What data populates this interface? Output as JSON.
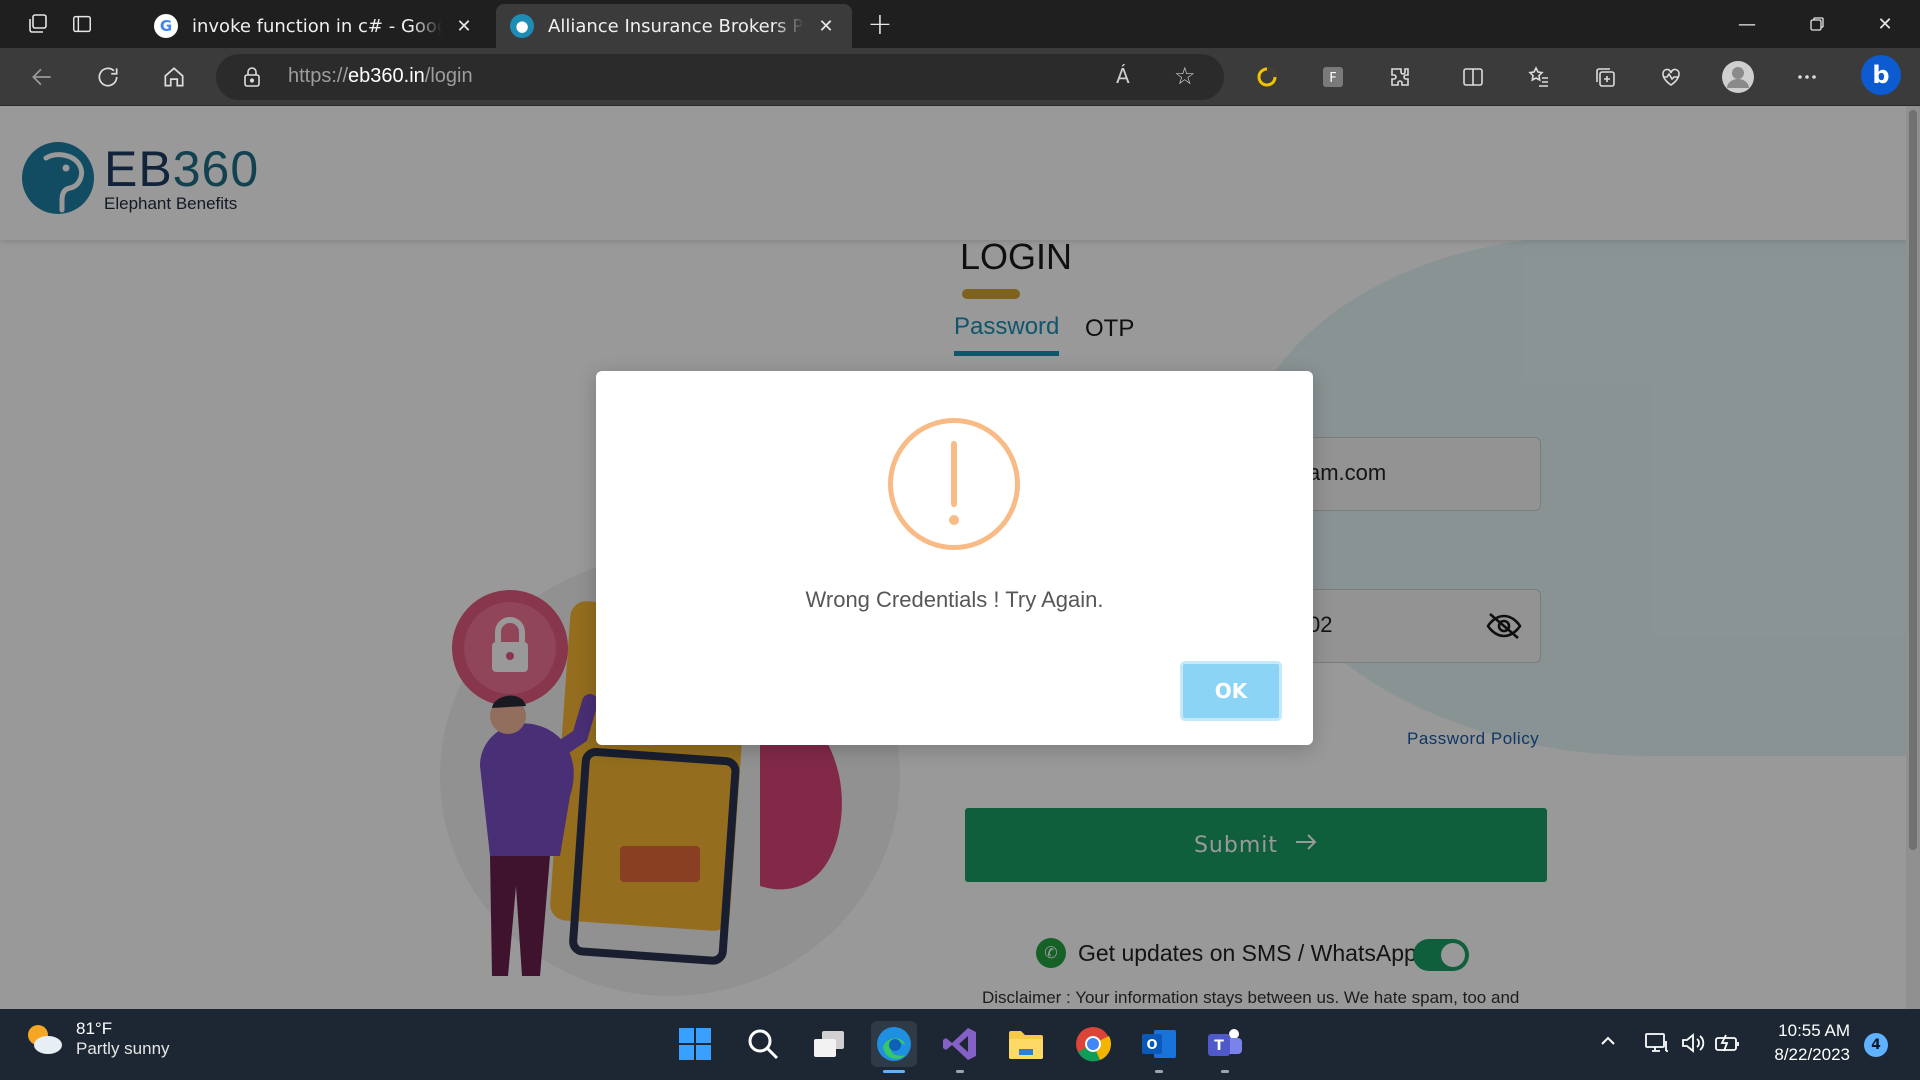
{
  "browser": {
    "tabs": [
      {
        "title": "invoke function in c# - Google Search",
        "active": false
      },
      {
        "title": "Alliance Insurance Brokers Pvt. Ltd",
        "active": true
      }
    ],
    "url_scheme": "https://",
    "url_host": "eb360.in",
    "url_path": "/login",
    "read_aloud_label": "Á"
  },
  "header": {
    "brand_eb": "EB",
    "brand_num": "360",
    "tagline": "Elephant Benefits"
  },
  "login": {
    "title": "LOGIN",
    "tabs": [
      "Password",
      "OTP"
    ],
    "email_visible": "am.com",
    "password_visible": "02",
    "password_policy": "Password Policy",
    "submit_label": "Submit",
    "updates_label": "Get updates on SMS / WhatsApp",
    "disclaimer": "Disclaimer : Your information stays between us. We hate spam, too and"
  },
  "modal": {
    "message": "Wrong Credentials ! Try Again.",
    "ok_label": "OK"
  },
  "taskbar": {
    "temperature": "81°F",
    "condition": "Partly sunny",
    "time": "10:55 AM",
    "date": "8/22/2023",
    "notifications": "4"
  },
  "colors": {
    "accent_blue": "#1a8fb5",
    "submit_green": "#1a9e66",
    "warning_orange": "#f8bb86",
    "ok_blue": "#8cd4f5",
    "underline_gold": "#d2a533"
  }
}
